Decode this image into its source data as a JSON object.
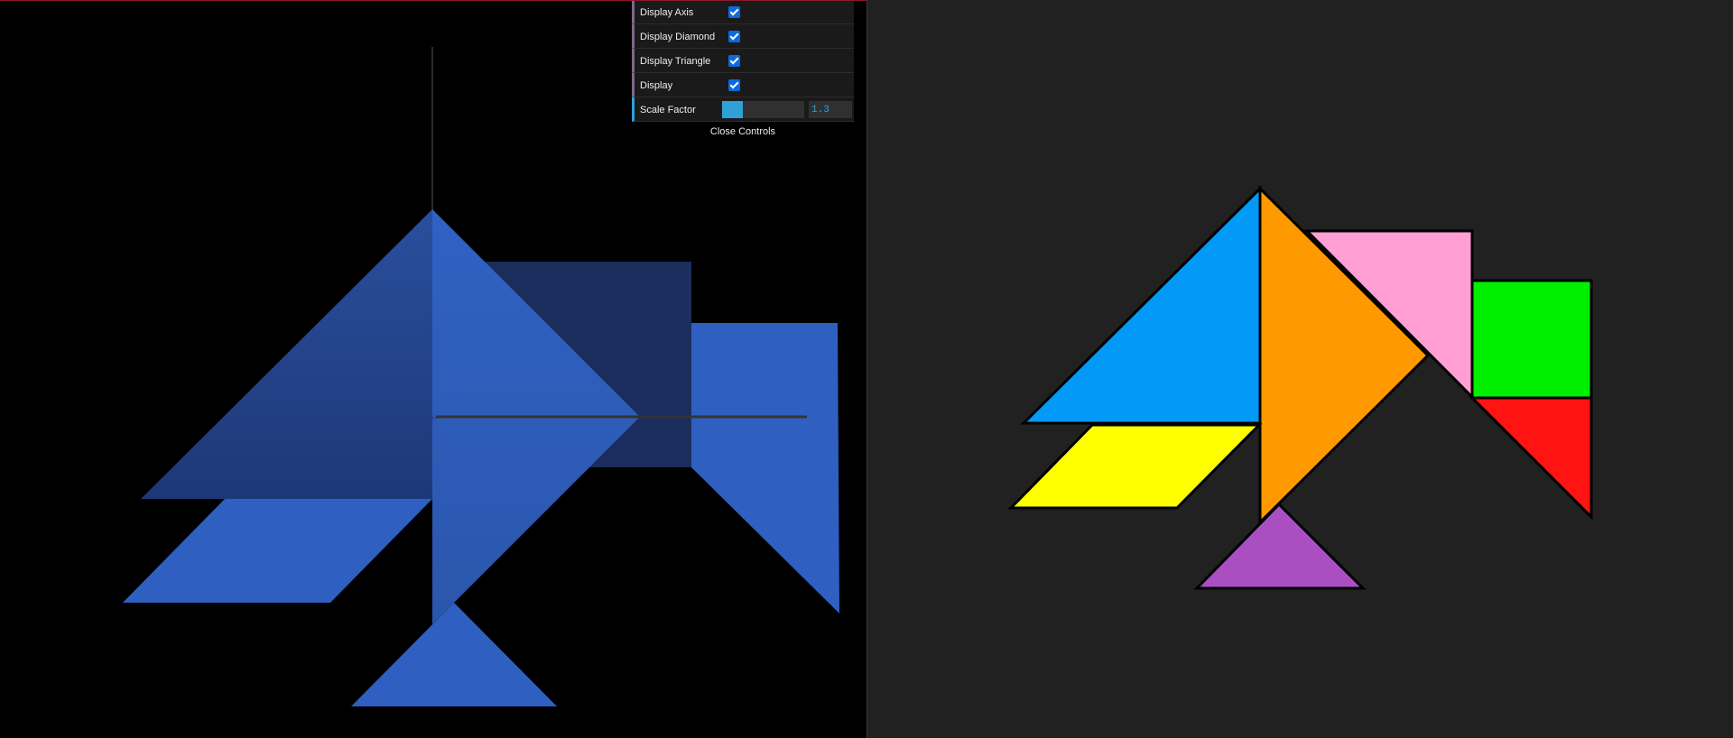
{
  "controls": {
    "rows": [
      {
        "label": "Display Axis",
        "checked": true
      },
      {
        "label": "Display Diamond",
        "checked": true
      },
      {
        "label": "Display Triangle",
        "checked": true
      },
      {
        "label": "Display",
        "checked": true
      }
    ],
    "scale": {
      "label": "Scale Factor",
      "value": "1.3",
      "fill_fraction": 0.25
    },
    "close_label": "Close Controls"
  },
  "colors": {
    "scene_background": "#000000",
    "viewer_background": "#212121",
    "axis": "#333333",
    "blue_light": "#2f5fc0",
    "blue_mid": "#2a4f9e",
    "blue_dark": "#1a2d5c",
    "tan_blue": "#0399f6",
    "tan_orange": "#ff9900",
    "tan_pink": "#ff9fd4",
    "tan_green": "#00ef00",
    "tan_red": "#ff1313",
    "tan_yellow": "#ffff00",
    "tan_purple": "#a94fc2",
    "outline": "#000000"
  }
}
